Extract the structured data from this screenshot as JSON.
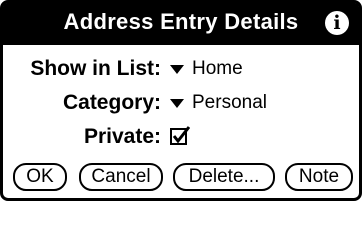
{
  "dialog": {
    "title": "Address Entry Details",
    "info_icon": "info-icon"
  },
  "fields": {
    "show_in_list": {
      "label": "Show in List:",
      "value": "Home"
    },
    "category": {
      "label": "Category:",
      "value": "Personal"
    },
    "private": {
      "label": "Private:",
      "checked": true
    }
  },
  "buttons": {
    "ok": "OK",
    "cancel": "Cancel",
    "delete": "Delete...",
    "note": "Note"
  }
}
